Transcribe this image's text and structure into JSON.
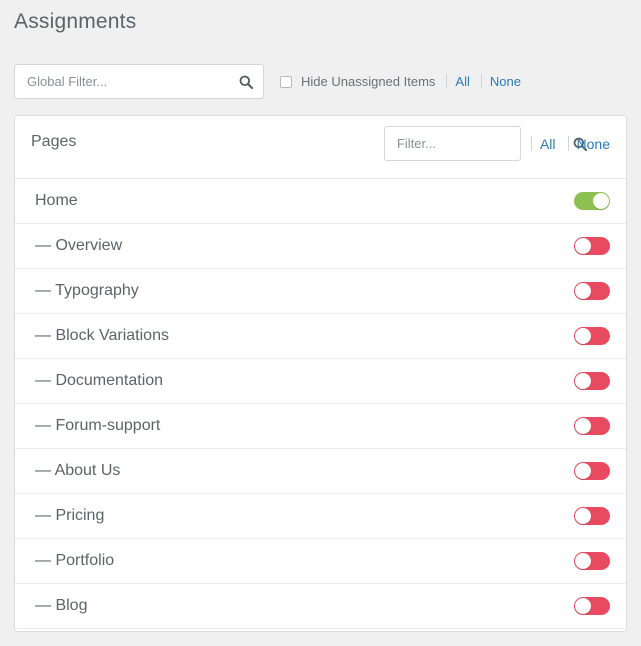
{
  "page": {
    "title": "Assignments"
  },
  "global_filter": {
    "placeholder": "Global Filter...",
    "hide_unassigned_label": "Hide Unassigned Items",
    "hide_unassigned_checked": false,
    "all_label": "All",
    "none_label": "None"
  },
  "panel": {
    "title": "Pages",
    "filter_placeholder": "Filter...",
    "all_label": "All",
    "none_label": "None",
    "items": [
      {
        "label": "Home",
        "enabled": true
      },
      {
        "label": "— Overview",
        "enabled": false
      },
      {
        "label": "— Typography",
        "enabled": false
      },
      {
        "label": "— Block Variations",
        "enabled": false
      },
      {
        "label": "— Documentation",
        "enabled": false
      },
      {
        "label": "— Forum-support",
        "enabled": false
      },
      {
        "label": "— About Us",
        "enabled": false
      },
      {
        "label": "— Pricing",
        "enabled": false
      },
      {
        "label": "— Portfolio",
        "enabled": false
      },
      {
        "label": "— Blog",
        "enabled": false
      }
    ]
  },
  "colors": {
    "toggle_on": "#8cc152",
    "toggle_off": "#e84a5f",
    "link": "#2a7bb8"
  }
}
